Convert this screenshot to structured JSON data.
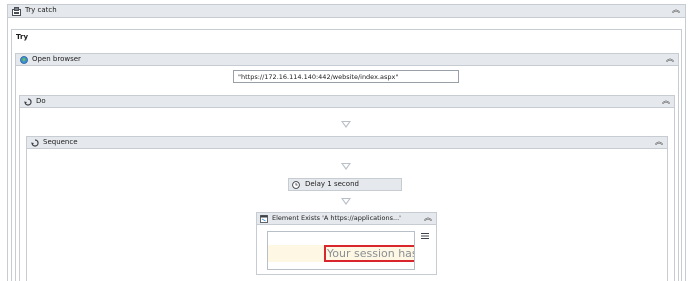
{
  "try_catch": {
    "title": "Try catch"
  },
  "try_section": {
    "label": "Try"
  },
  "open_browser": {
    "title": "Open browser",
    "url_value": "\"https://172.16.114.140:442/website/index.aspx\""
  },
  "do_block": {
    "title": "Do"
  },
  "sequence": {
    "title": "Sequence"
  },
  "delay": {
    "title": "Delay 1 second"
  },
  "element_exists": {
    "title": "Element Exists 'A  https://applications...'",
    "preview_text": "Your session has t"
  },
  "icons": {
    "try_catch": "try-catch-icon",
    "open_browser": "globe-icon",
    "do": "loop-icon",
    "sequence": "sequence-icon",
    "delay": "clock-icon",
    "element_exists": "window-icon",
    "collapse": "double-chevron-up-icon",
    "menu": "hamburger-icon",
    "drop": "drop-target-arrow-icon"
  },
  "colors": {
    "header_bg": "#e5e8ec",
    "border": "#c7ccd3",
    "highlight_red": "#d9262c",
    "highlight_bg": "#fdf7e3"
  }
}
